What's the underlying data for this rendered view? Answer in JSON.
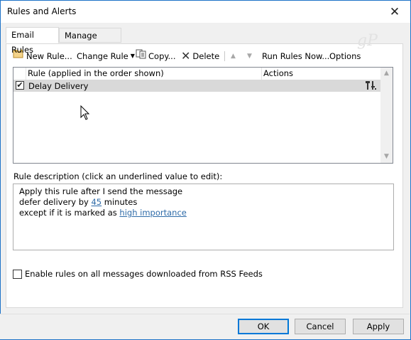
{
  "window": {
    "title": "Rules and Alerts"
  },
  "tabs": [
    "Email Rules",
    "Manage Alerts"
  ],
  "watermark": "gP",
  "toolbar": {
    "new_rule": "New Rule...",
    "change_rule": "Change Rule",
    "copy": "Copy...",
    "delete": "Delete",
    "run_rules_now": "Run Rules Now...",
    "options": "Options"
  },
  "rules_list": {
    "columns": [
      "Rule (applied in the order shown)",
      "Actions"
    ],
    "rows": [
      {
        "name": "Delay Delivery",
        "checked": true
      }
    ]
  },
  "description": {
    "label": "Rule description (click an underlined value to edit):",
    "line1": "Apply this rule after I send the message",
    "line2_prefix": "defer delivery by",
    "line2_link": "45",
    "line2_suffix": "minutes",
    "line3_prefix": "except if it is marked as",
    "line3_link": "high importance"
  },
  "rss_checkbox_label": "Enable rules on all messages downloaded from RSS Feeds",
  "buttons": {
    "ok": "OK",
    "cancel": "Cancel",
    "apply": "Apply"
  }
}
